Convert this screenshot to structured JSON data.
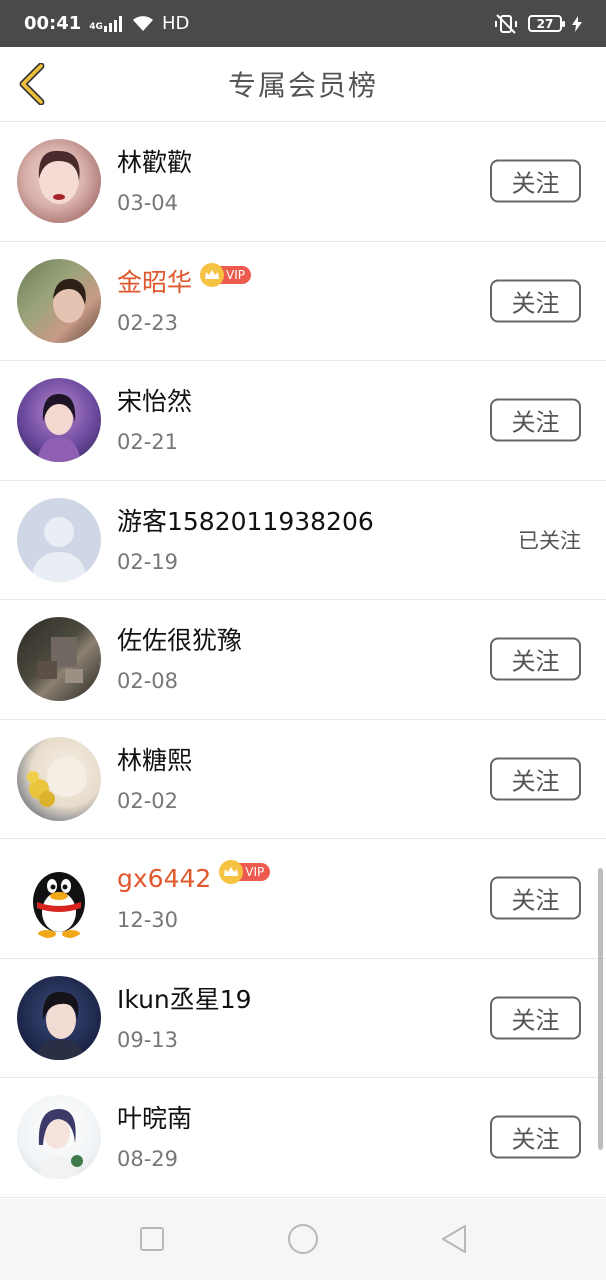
{
  "status_bar": {
    "time": "00:41",
    "network": "4G",
    "hd": "HD",
    "battery": "27"
  },
  "header": {
    "title": "专属会员榜",
    "back_icon": "chevron-left-icon"
  },
  "members": [
    {
      "name": "林歡歡",
      "date": "03-04",
      "vip": false,
      "follow_label": "关注",
      "followed": false
    },
    {
      "name": "金昭华",
      "date": "02-23",
      "vip": true,
      "vip_label": "VIP",
      "follow_label": "关注",
      "followed": false
    },
    {
      "name": "宋怡然",
      "date": "02-21",
      "vip": false,
      "follow_label": "关注",
      "followed": false
    },
    {
      "name": "游客1582011938206",
      "date": "02-19",
      "vip": false,
      "follow_label": "已关注",
      "followed": true
    },
    {
      "name": "佐佐很犹豫",
      "date": "02-08",
      "vip": false,
      "follow_label": "关注",
      "followed": false
    },
    {
      "name": "林糖熙",
      "date": "02-02",
      "vip": false,
      "follow_label": "关注",
      "followed": false
    },
    {
      "name": "gx6442",
      "date": "12-30",
      "vip": true,
      "vip_label": "VIP",
      "follow_label": "关注",
      "followed": false
    },
    {
      "name": "Ikun丞星19",
      "date": "09-13",
      "vip": false,
      "follow_label": "关注",
      "followed": false
    },
    {
      "name": "叶晥南",
      "date": "08-29",
      "vip": false,
      "follow_label": "关注",
      "followed": false
    }
  ],
  "colors": {
    "accent_yellow": "#f0c13a",
    "vip_name": "#e0582d",
    "vip_tag": "#ec5b4e"
  },
  "nav_bar": {
    "recent_icon": "square-icon",
    "home_icon": "circle-icon",
    "back_icon": "triangle-back-icon"
  }
}
